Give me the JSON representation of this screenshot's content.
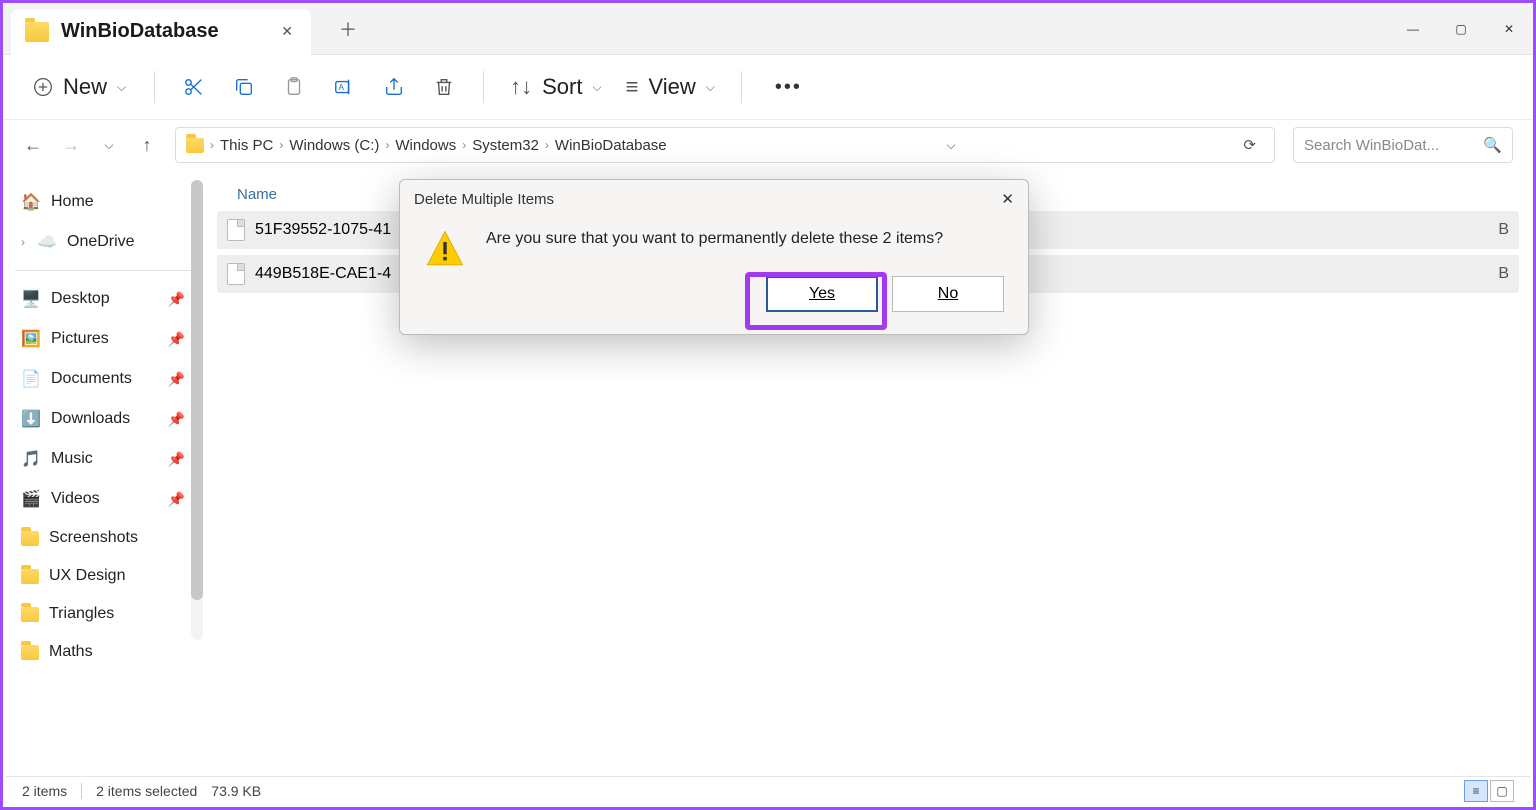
{
  "window": {
    "tab_title": "WinBioDatabase"
  },
  "toolbar": {
    "new_label": "New",
    "sort_label": "Sort",
    "view_label": "View"
  },
  "breadcrumb": [
    "This PC",
    "Windows (C:)",
    "Windows",
    "System32",
    "WinBioDatabase"
  ],
  "search": {
    "placeholder": "Search WinBioDat..."
  },
  "sidebar": {
    "home": "Home",
    "onedrive": "OneDrive",
    "items": [
      "Desktop",
      "Pictures",
      "Documents",
      "Downloads",
      "Music",
      "Videos",
      "Screenshots",
      "UX Design",
      "Triangles",
      "Maths"
    ]
  },
  "list": {
    "header_name": "Name",
    "rows": [
      {
        "name": "51F39552-1075-41",
        "trail": "B"
      },
      {
        "name": "449B518E-CAE1-4",
        "trail": "B"
      }
    ]
  },
  "dialog": {
    "title": "Delete Multiple Items",
    "message": "Are you sure that you want to permanently delete these 2 items?",
    "yes": "Yes",
    "no": "No"
  },
  "status": {
    "count": "2 items",
    "selected": "2 items selected",
    "size": "73.9 KB"
  }
}
